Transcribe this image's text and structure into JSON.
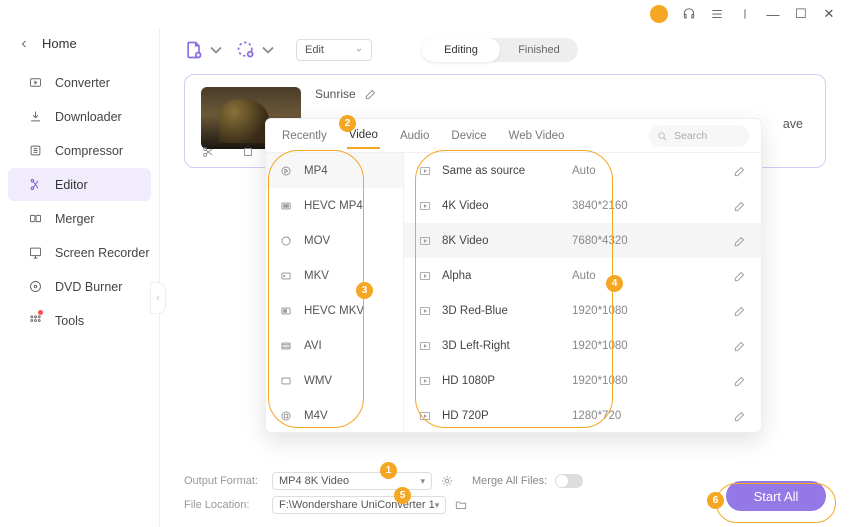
{
  "titlebar": {
    "minimize": "—",
    "maximize": "☐",
    "close": "✕"
  },
  "home_label": "Home",
  "sidebar": {
    "items": [
      {
        "label": "Converter"
      },
      {
        "label": "Downloader"
      },
      {
        "label": "Compressor"
      },
      {
        "label": "Editor"
      },
      {
        "label": "Merger"
      },
      {
        "label": "Screen Recorder"
      },
      {
        "label": "DVD Burner"
      },
      {
        "label": "Tools"
      }
    ]
  },
  "toolbar": {
    "edit_label": "Edit",
    "seg_editing": "Editing",
    "seg_finished": "Finished"
  },
  "card": {
    "filename": "Sunrise",
    "save_label": "ave"
  },
  "panel": {
    "tabs": [
      "Recently",
      "Video",
      "Audio",
      "Device",
      "Web Video"
    ],
    "search_placeholder": "Search",
    "formats": [
      "MP4",
      "HEVC MP4",
      "MOV",
      "MKV",
      "HEVC MKV",
      "AVI",
      "WMV",
      "M4V"
    ],
    "presets": [
      {
        "name": "Same as source",
        "res": "Auto"
      },
      {
        "name": "4K Video",
        "res": "3840*2160"
      },
      {
        "name": "8K Video",
        "res": "7680*4320"
      },
      {
        "name": "Alpha",
        "res": "Auto"
      },
      {
        "name": "3D Red-Blue",
        "res": "1920*1080"
      },
      {
        "name": "3D Left-Right",
        "res": "1920*1080"
      },
      {
        "name": "HD 1080P",
        "res": "1920*1080"
      },
      {
        "name": "HD 720P",
        "res": "1280*720"
      }
    ]
  },
  "footer": {
    "output_label": "Output Format:",
    "output_value": "MP4 8K Video",
    "location_label": "File Location:",
    "location_value": "F:\\Wondershare UniConverter 1",
    "merge_label": "Merge All Files:",
    "start_label": "Start All"
  },
  "badges": {
    "b1": "1",
    "b2": "2",
    "b3": "3",
    "b4": "4",
    "b5": "5",
    "b6": "6"
  }
}
